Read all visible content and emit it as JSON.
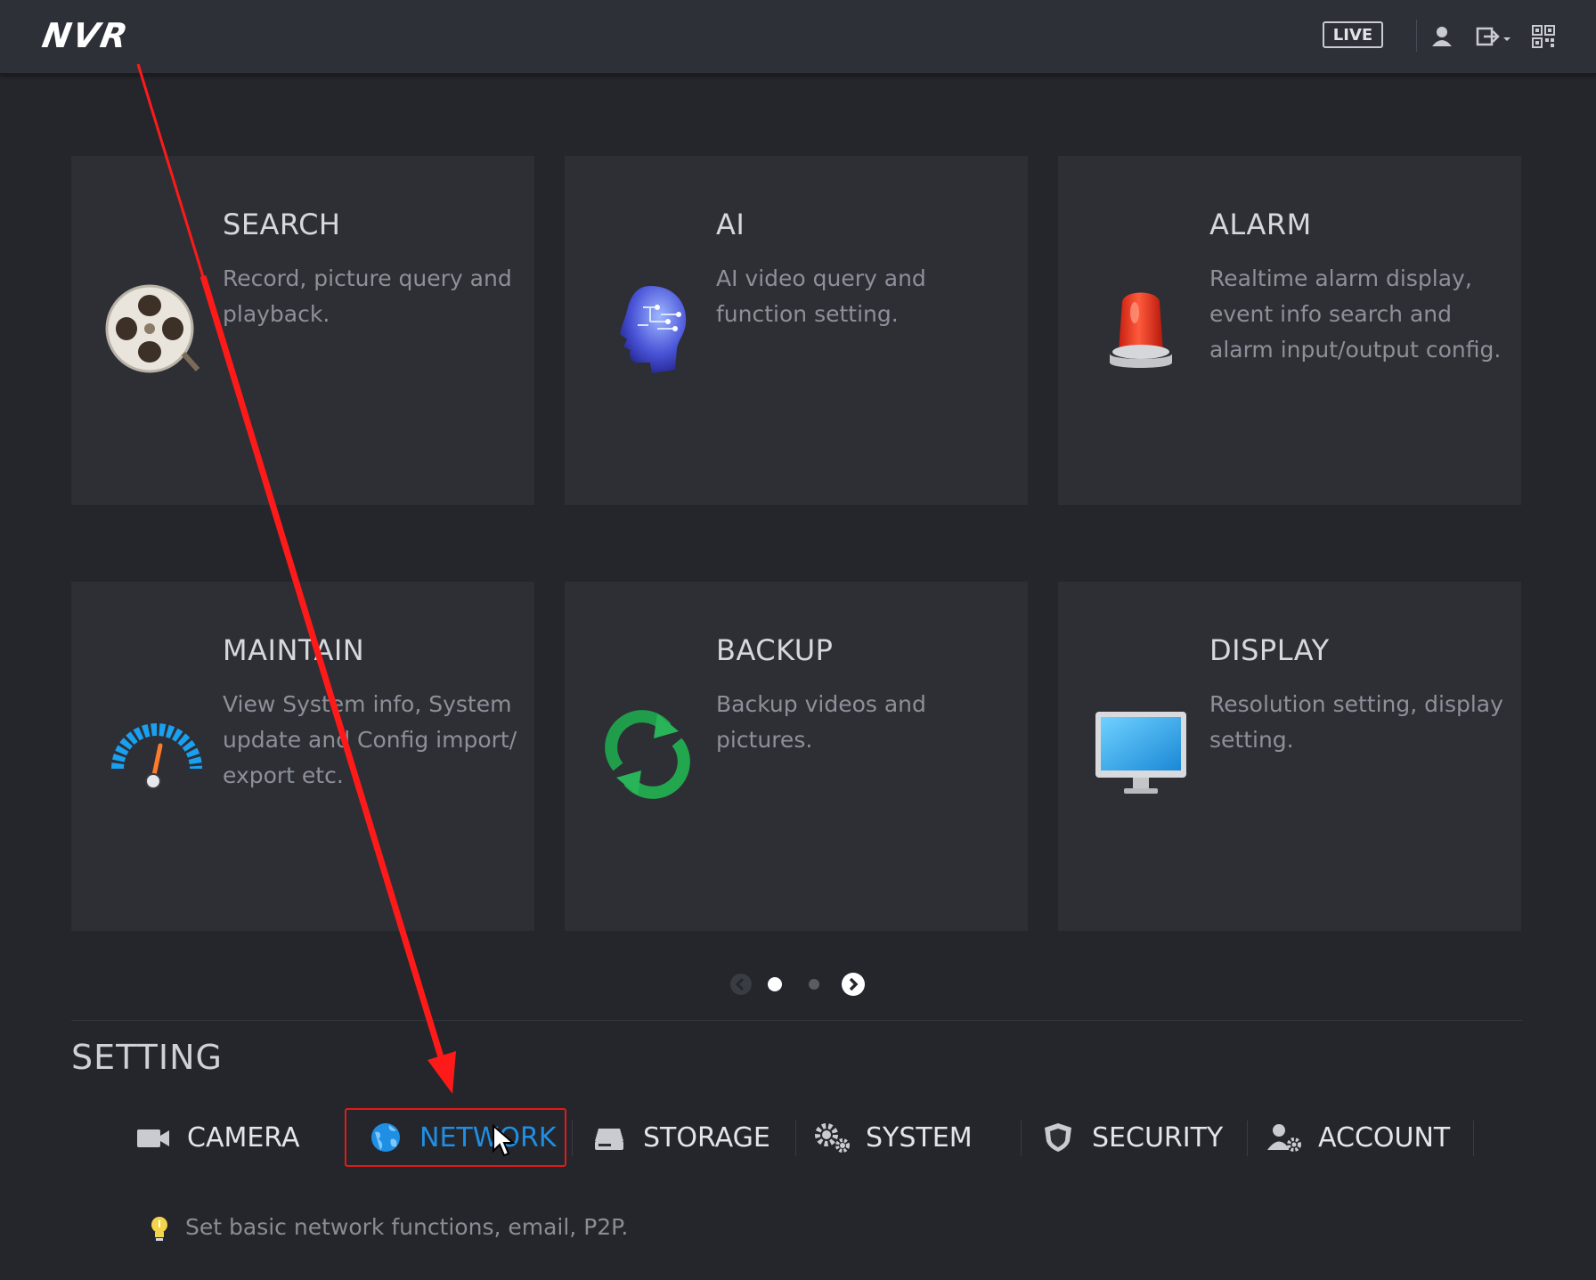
{
  "header": {
    "logo": "NVR",
    "live_label": "LIVE",
    "icons": [
      "user-icon",
      "logout-icon",
      "qr-code-icon"
    ]
  },
  "tiles": [
    {
      "title": "SEARCH",
      "desc": "Record, picture query and playback.",
      "icon": "film-reel-icon"
    },
    {
      "title": "AI",
      "desc": "AI video query and function setting.",
      "icon": "ai-brain-icon"
    },
    {
      "title": "ALARM",
      "desc": "Realtime alarm display, event info search and alarm input/output config.",
      "icon": "alarm-siren-icon"
    },
    {
      "title": "MAINTAIN",
      "desc": "View System info, System update and Config import/ export etc.",
      "icon": "gauge-icon"
    },
    {
      "title": "BACKUP",
      "desc": "Backup videos and pictures.",
      "icon": "refresh-arrows-icon"
    },
    {
      "title": "DISPLAY",
      "desc": "Resolution setting, display setting.",
      "icon": "monitor-icon"
    }
  ],
  "pager": {
    "pages": 2,
    "current": 1
  },
  "setting": {
    "title": "SETTING",
    "items": [
      {
        "label": "CAMERA",
        "icon": "camera-icon"
      },
      {
        "label": "NETWORK",
        "icon": "globe-icon",
        "active": true
      },
      {
        "label": "STORAGE",
        "icon": "hard-drive-icon"
      },
      {
        "label": "SYSTEM",
        "icon": "gears-icon"
      },
      {
        "label": "SECURITY",
        "icon": "shield-icon"
      },
      {
        "label": "ACCOUNT",
        "icon": "user-gear-icon"
      }
    ],
    "hint": "Set basic network functions, email, P2P."
  },
  "colors": {
    "accent": "#1f8fe3",
    "highlight_border": "#e01b1b",
    "annotation_arrow": "#ff1a1a"
  }
}
